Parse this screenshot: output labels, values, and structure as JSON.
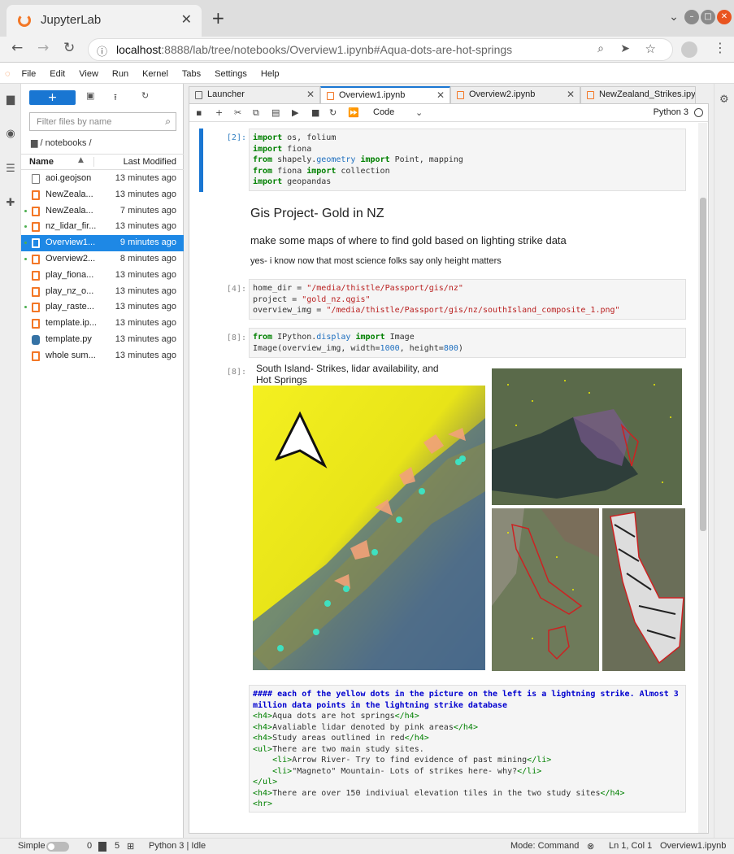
{
  "browser": {
    "tab_title": "JupyterLab",
    "url_host": "localhost",
    "url_rest": ":8888/lab/tree/notebooks/Overview1.ipynb#Aqua-dots-are-hot-springs"
  },
  "menu": [
    "File",
    "Edit",
    "View",
    "Run",
    "Kernel",
    "Tabs",
    "Settings",
    "Help"
  ],
  "filebrowser": {
    "new_label": "+",
    "filter_placeholder": "Filter files by name",
    "breadcrumb": "/ notebooks /",
    "col_name": "Name",
    "col_modified": "Last Modified",
    "files": [
      {
        "name": "aoi.geojson",
        "modified": "13 minutes ago",
        "type": "file",
        "running": false
      },
      {
        "name": "NewZeala...",
        "modified": "13 minutes ago",
        "type": "notebook",
        "running": false
      },
      {
        "name": "NewZeala...",
        "modified": "7 minutes ago",
        "type": "notebook",
        "running": true
      },
      {
        "name": "nz_lidar_fir...",
        "modified": "13 minutes ago",
        "type": "notebook",
        "running": true
      },
      {
        "name": "Overview1...",
        "modified": "9 minutes ago",
        "type": "notebook",
        "running": true,
        "selected": true
      },
      {
        "name": "Overview2...",
        "modified": "8 minutes ago",
        "type": "notebook",
        "running": true
      },
      {
        "name": "play_fiona...",
        "modified": "13 minutes ago",
        "type": "notebook",
        "running": false
      },
      {
        "name": "play_nz_o...",
        "modified": "13 minutes ago",
        "type": "notebook",
        "running": false
      },
      {
        "name": "play_raste...",
        "modified": "13 minutes ago",
        "type": "notebook",
        "running": true
      },
      {
        "name": "template.ip...",
        "modified": "13 minutes ago",
        "type": "notebook",
        "running": false
      },
      {
        "name": "template.py",
        "modified": "13 minutes ago",
        "type": "python",
        "running": false
      },
      {
        "name": "whole sum...",
        "modified": "13 minutes ago",
        "type": "notebook",
        "running": false
      }
    ]
  },
  "doctabs": [
    {
      "label": "Launcher",
      "active": false
    },
    {
      "label": "Overview1.ipynb",
      "active": true
    },
    {
      "label": "Overview2.ipynb",
      "active": false
    },
    {
      "label": "NewZealand_Strikes.ipynb",
      "active": false
    }
  ],
  "toolbar": {
    "cell_type": "Code",
    "kernel": "Python 3"
  },
  "cells": {
    "c1_prompt": "[2]:",
    "md_title": "Gis Project- Gold in NZ",
    "md_sub": "make some maps of where to find gold based on lighting strike data",
    "md_note": "yes- i know now that most science folks say only height matters",
    "c2_prompt": "[4]:",
    "c3_prompt": "[8]:",
    "out_prompt": "[8]:",
    "figure_title": "South Island- Strikes, lidar availability,  and Hot Springs"
  },
  "status": {
    "simple": "Simple",
    "terminals": "0",
    "kernels": "5",
    "kernel_state": "Python 3 | Idle",
    "mode": "Mode: Command",
    "position": "Ln 1, Col 1",
    "file": "Overview1.ipynb"
  },
  "colors": {
    "accent": "#1976d2",
    "jupyter_orange": "#f37726",
    "selected_row": "#1e88e5"
  }
}
